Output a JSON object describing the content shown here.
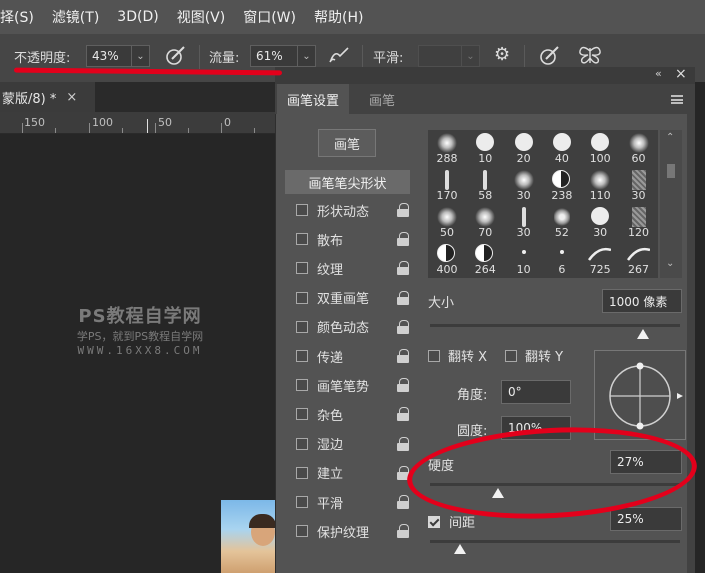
{
  "menu": [
    "择(S)",
    "滤镜(T)",
    "3D(D)",
    "视图(V)",
    "窗口(W)",
    "帮助(H)"
  ],
  "options": {
    "opacity_label": "不透明度:",
    "opacity_value": "43%",
    "flow_label": "流量:",
    "flow_value": "61%",
    "smooth_label": "平滑:",
    "smooth_value": ""
  },
  "document": {
    "tab_title": "蒙版/8) *",
    "tab_close": "×",
    "ruler_labels": [
      "150",
      "100",
      "50",
      "0"
    ]
  },
  "watermark": {
    "title": "PS教程自学网",
    "subtitle": "学PS，就到PS教程自学网",
    "url": "WWW.16XX8.COM"
  },
  "panel": {
    "collapse_glyph": "«",
    "close_glyph": "×",
    "tabs": [
      "画笔设置",
      "画笔"
    ],
    "brush_button": "画笔",
    "tip_shape": "画笔笔尖形状",
    "options": [
      {
        "label": "形状动态",
        "checked": false
      },
      {
        "label": "散布",
        "checked": false
      },
      {
        "label": "纹理",
        "checked": false
      },
      {
        "label": "双重画笔",
        "checked": false
      },
      {
        "label": "颜色动态",
        "checked": false
      },
      {
        "label": "传递",
        "checked": false
      },
      {
        "label": "画笔笔势",
        "checked": false
      },
      {
        "label": "杂色",
        "checked": false
      },
      {
        "label": "湿边",
        "checked": false
      },
      {
        "label": "建立",
        "checked": false
      },
      {
        "label": "平滑",
        "checked": false
      },
      {
        "label": "保护纹理",
        "checked": false
      }
    ],
    "brush_sizes": [
      "288",
      "10",
      "20",
      "40",
      "100",
      "60",
      "170",
      "58",
      "30",
      "238",
      "110",
      "30",
      "50",
      "70",
      "30",
      "52",
      "30",
      "120",
      "400",
      "264",
      "10",
      "6",
      "725",
      "267"
    ],
    "size_label": "大小",
    "size_value": "1000 像素",
    "size_slider": 0.85,
    "flip_x": "翻转 X",
    "flip_y": "翻转 Y",
    "angle_label": "角度:",
    "angle_value": "0°",
    "roundness_label": "圆度:",
    "roundness_value": "100%",
    "hardness_label": "硬度",
    "hardness_value": "27%",
    "hardness_slider": 0.27,
    "spacing_label": "间距",
    "spacing_value": "25%",
    "spacing_checked": true,
    "spacing_slider": 0.12
  },
  "colors": {
    "menubar": "#535353",
    "panel": "#535353",
    "annotation": "#e3001b"
  }
}
